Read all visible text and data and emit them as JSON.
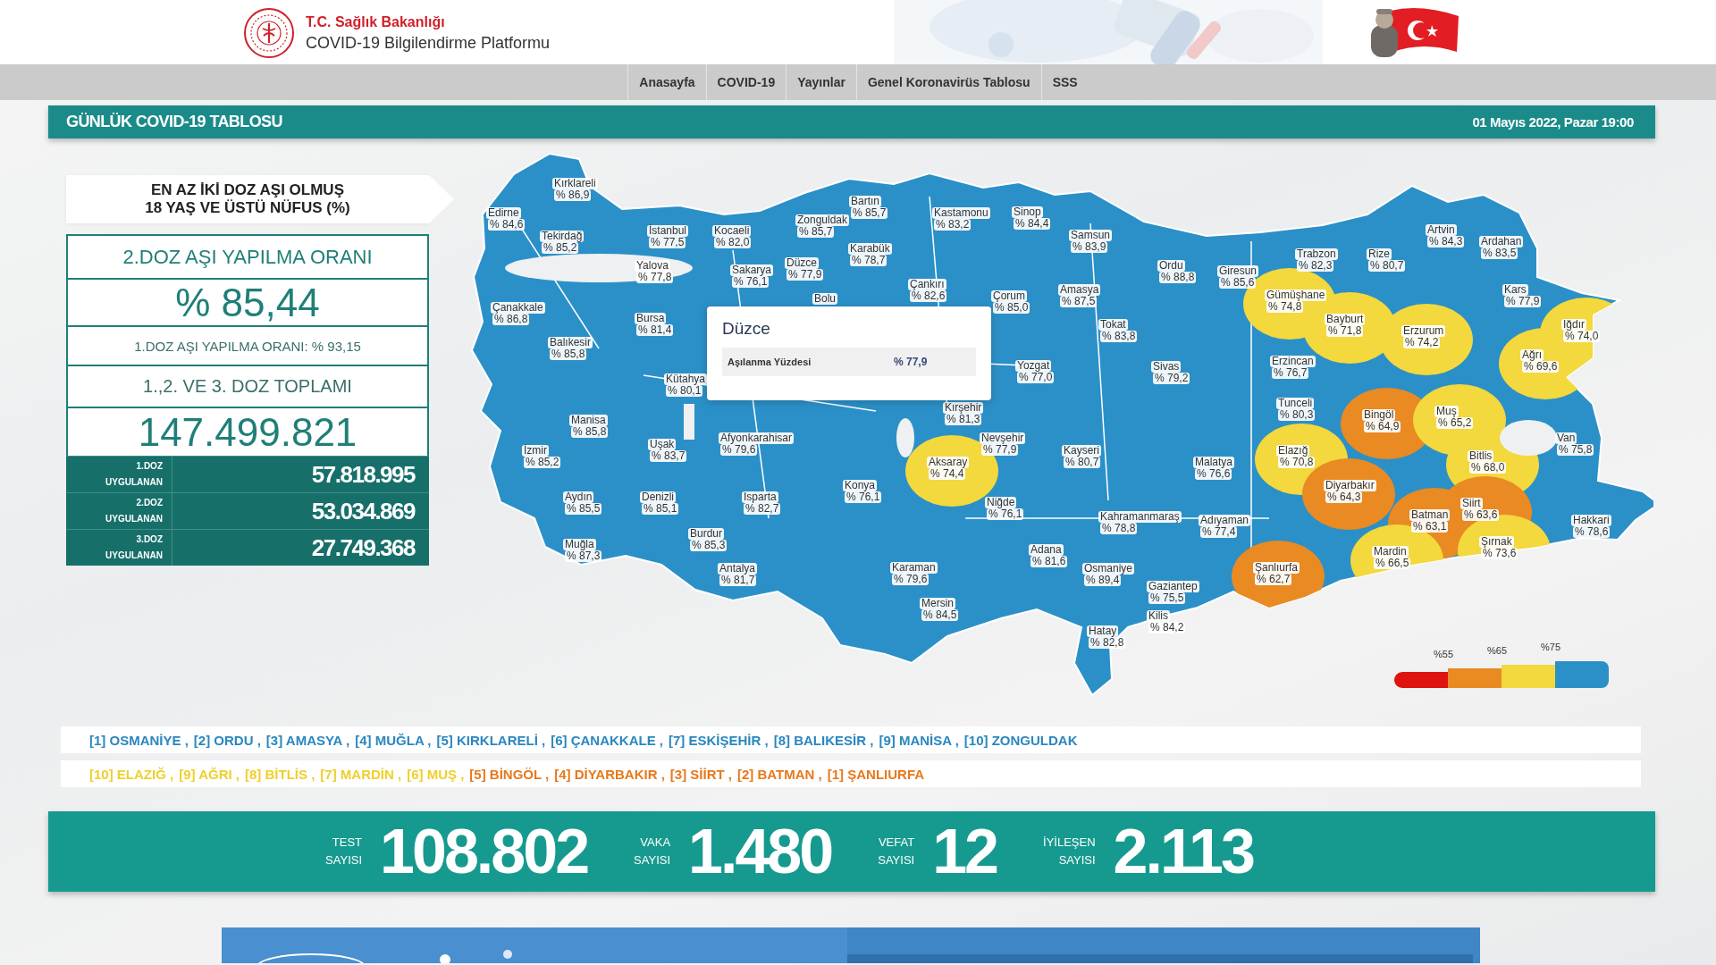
{
  "header": {
    "ministry": "T.C. Sağlık Bakanlığı",
    "platform": "COVID-19 Bilgilendirme Platformu"
  },
  "nav": [
    "Anasayfa",
    "COVID-19",
    "Yayınlar",
    "Genel Koronavirüs Tablosu",
    "SSS"
  ],
  "title_bar": {
    "title": "GÜNLÜK COVID-19 TABLOSU",
    "date": "01 Mayıs 2022, Pazar 19:00"
  },
  "vaccination": {
    "heading_lines": [
      "EN AZ İKİ DOZ AŞI OLMUŞ",
      "18 YAŞ VE ÜSTÜ NÜFUS (%)"
    ],
    "second_dose_title": "2.DOZ AŞI YAPILMA ORANI",
    "second_dose_rate": "% 85,44",
    "first_dose_rate": "1.DOZ AŞI YAPILMA ORANI: % 93,15",
    "total_title": "1.,2. VE 3. DOZ TOPLAMI",
    "total": "147.499.821",
    "doses": [
      {
        "label_lines": [
          "1.DOZ",
          "UYGULANAN"
        ],
        "value": "57.818.995"
      },
      {
        "label_lines": [
          "2.DOZ",
          "UYGULANAN"
        ],
        "value": "53.034.869"
      },
      {
        "label_lines": [
          "3.DOZ",
          "UYGULANAN"
        ],
        "value": "27.749.368"
      }
    ]
  },
  "map": {
    "provinces": [
      {
        "name": "Kırklareli",
        "value": "% 86,9"
      },
      {
        "name": "Edirne",
        "value": "% 84,6"
      },
      {
        "name": "Zonguldak",
        "value": "% 85,7"
      },
      {
        "name": "Bartın",
        "value": "% 85,7"
      },
      {
        "name": "Kastamonu",
        "value": "% 83,2"
      },
      {
        "name": "Sinop",
        "value": "% 84,4"
      },
      {
        "name": "Tekirdağ",
        "value": "% 85,2"
      },
      {
        "name": "İstanbul",
        "value": "% 77,5"
      },
      {
        "name": "Kocaeli",
        "value": "% 82,0"
      },
      {
        "name": "Samsun",
        "value": "% 83,9"
      },
      {
        "name": "Artvin",
        "value": "% 84,3"
      },
      {
        "name": "Karabük",
        "value": "% 78,7"
      },
      {
        "name": "Ardahan",
        "value": "% 83,5"
      },
      {
        "name": "Yalova",
        "value": "% 77,8"
      },
      {
        "name": "Sakarya",
        "value": "% 76,1"
      },
      {
        "name": "Düzce",
        "value": "% 77,9"
      },
      {
        "name": "Ordu",
        "value": "% 88,8"
      },
      {
        "name": "Giresun",
        "value": "% 85,6"
      },
      {
        "name": "Trabzon",
        "value": "% 82,3"
      },
      {
        "name": "Rize",
        "value": "% 80,7"
      },
      {
        "name": "Bolu"
      },
      {
        "name": "Çankırı",
        "value": "% 82,6"
      },
      {
        "name": "Çorum",
        "value": "% 85,0"
      },
      {
        "name": "Amasya",
        "value": "% 87,5"
      },
      {
        "name": "Gümüşhane",
        "value": "% 74,8"
      },
      {
        "name": "Kars",
        "value": "% 77,9"
      },
      {
        "name": "Çanakkale",
        "value": "% 86,8"
      },
      {
        "name": "Bursa",
        "value": "% 81,4"
      },
      {
        "name": "Tokat",
        "value": "% 83,8"
      },
      {
        "name": "Bayburt",
        "value": "% 71,8"
      },
      {
        "name": "Erzurum",
        "value": "% 74,2"
      },
      {
        "name": "Iğdır",
        "value": "% 74,0"
      },
      {
        "name": "Balıkesir",
        "value": "% 85,8"
      },
      {
        "name": "Yozgat",
        "value": "% 77,0"
      },
      {
        "name": "Sivas",
        "value": "% 79,2"
      },
      {
        "name": "Erzincan",
        "value": "% 76,7"
      },
      {
        "name": "Ağrı",
        "value": "% 69,6"
      },
      {
        "name": "Kütahya",
        "value": "% 80,1"
      },
      {
        "name": "Manisa",
        "value": "% 85,8"
      },
      {
        "name": "Kırşehir",
        "value": "% 81,3"
      },
      {
        "name": "Tunceli",
        "value": "% 80,3"
      },
      {
        "name": "Bingöl",
        "value": "% 64,9"
      },
      {
        "name": "Muş",
        "value": "% 65,2"
      },
      {
        "name": "Uşak",
        "value": "% 83,7"
      },
      {
        "name": "Afyonkarahisar",
        "value": "% 79,6"
      },
      {
        "name": "Nevşehir",
        "value": "% 77,9"
      },
      {
        "name": "Van",
        "value": "% 75,8"
      },
      {
        "name": "İzmir",
        "value": "% 85,2"
      },
      {
        "name": "Aksaray",
        "value": "% 74,4"
      },
      {
        "name": "Kayseri",
        "value": "% 80,7"
      },
      {
        "name": "Malatya",
        "value": "% 76,6"
      },
      {
        "name": "Elazığ",
        "value": "% 70,8"
      },
      {
        "name": "Bitlis",
        "value": "% 68,0"
      },
      {
        "name": "Aydın",
        "value": "% 85,5"
      },
      {
        "name": "Denizli",
        "value": "% 85,1"
      },
      {
        "name": "Isparta",
        "value": "% 82,7"
      },
      {
        "name": "Konya",
        "value": "% 76,1"
      },
      {
        "name": "Niğde",
        "value": "% 76,1"
      },
      {
        "name": "Diyarbakır",
        "value": "% 64,3"
      },
      {
        "name": "Siirt",
        "value": "% 63,6"
      },
      {
        "name": "Kahramanmaraş",
        "value": "% 78,8"
      },
      {
        "name": "Adıyaman",
        "value": "% 77,4"
      },
      {
        "name": "Batman",
        "value": "% 63,1"
      },
      {
        "name": "Hakkari",
        "value": "% 78,6"
      },
      {
        "name": "Muğla",
        "value": "% 87,3"
      },
      {
        "name": "Burdur",
        "value": "% 85,3"
      },
      {
        "name": "Adana",
        "value": "% 81,6"
      },
      {
        "name": "Mardin",
        "value": "% 66,5"
      },
      {
        "name": "Şırnak",
        "value": "% 73,6"
      },
      {
        "name": "Antalya",
        "value": "% 81,7"
      },
      {
        "name": "Karaman",
        "value": "% 79,6"
      },
      {
        "name": "Osmaniye",
        "value": "% 89,4"
      },
      {
        "name": "Şanlıurfa",
        "value": "% 62,7"
      },
      {
        "name": "Gaziantep",
        "value": "% 75,5"
      },
      {
        "name": "Mersin",
        "value": "% 84,5"
      },
      {
        "name": "Kilis",
        "value": "% 84,2"
      },
      {
        "name": "Hatay",
        "value": "% 82,8"
      }
    ],
    "tooltip": {
      "title": "Düzce",
      "label": "Aşılanma Yüzdesi",
      "value": "% 77,9"
    },
    "legend": {
      "bands": [
        {
          "color": "#df1410"
        },
        {
          "color": "#e98a22"
        },
        {
          "color": "#f3d83e"
        },
        {
          "color": "#2b90c8"
        }
      ],
      "labels": [
        "%55",
        "%65",
        "%75"
      ]
    }
  },
  "rankings": [
    {
      "items": [
        {
          "text": "[1] OSMANİYE ,",
          "color": "#2a87c0"
        },
        {
          "text": "[2] ORDU ,",
          "color": "#2a87c0"
        },
        {
          "text": "[3] AMASYA ,",
          "color": "#2a87c0"
        },
        {
          "text": "[4] MUĞLA ,",
          "color": "#2a87c0"
        },
        {
          "text": "[5] KIRKLARELİ ,",
          "color": "#2a87c0"
        },
        {
          "text": "[6] ÇANAKKALE ,",
          "color": "#2a87c0"
        },
        {
          "text": "[7] ESKİŞEHİR ,",
          "color": "#2a87c0"
        },
        {
          "text": "[8] BALIKESİR ,",
          "color": "#2a87c0"
        },
        {
          "text": "[9] MANİSA ,",
          "color": "#2a87c0"
        },
        {
          "text": "[10] ZONGULDAK",
          "color": "#2a87c0"
        }
      ]
    },
    {
      "items": [
        {
          "text": "[10] ELAZIĞ ,",
          "color": "#f0cf2c"
        },
        {
          "text": "[9] AĞRI ,",
          "color": "#f0cf2c"
        },
        {
          "text": "[8] BİTLİS ,",
          "color": "#f0cf2c"
        },
        {
          "text": "[7] MARDİN ,",
          "color": "#f0cf2c"
        },
        {
          "text": "[6] MUŞ ,",
          "color": "#f0cf2c"
        },
        {
          "text": "[5] BİNGÖL ,",
          "color": "#e8781a"
        },
        {
          "text": "[4] DİYARBAKIR ,",
          "color": "#e8781a"
        },
        {
          "text": "[3] SİİRT ,",
          "color": "#e8781a"
        },
        {
          "text": "[2] BATMAN ,",
          "color": "#e8781a"
        },
        {
          "text": "[1] ŞANLIURFA",
          "color": "#e8781a"
        }
      ]
    }
  ],
  "stats": [
    {
      "label_lines": [
        "TEST",
        "SAYISI"
      ],
      "value": "108.802"
    },
    {
      "label_lines": [
        "VAKA",
        "SAYISI"
      ],
      "value": "1.480"
    },
    {
      "label_lines": [
        "VEFAT",
        "SAYISI"
      ],
      "value": "12"
    },
    {
      "label_lines": [
        "İYİLEŞEN",
        "SAYISI"
      ],
      "value": "2.113"
    }
  ]
}
